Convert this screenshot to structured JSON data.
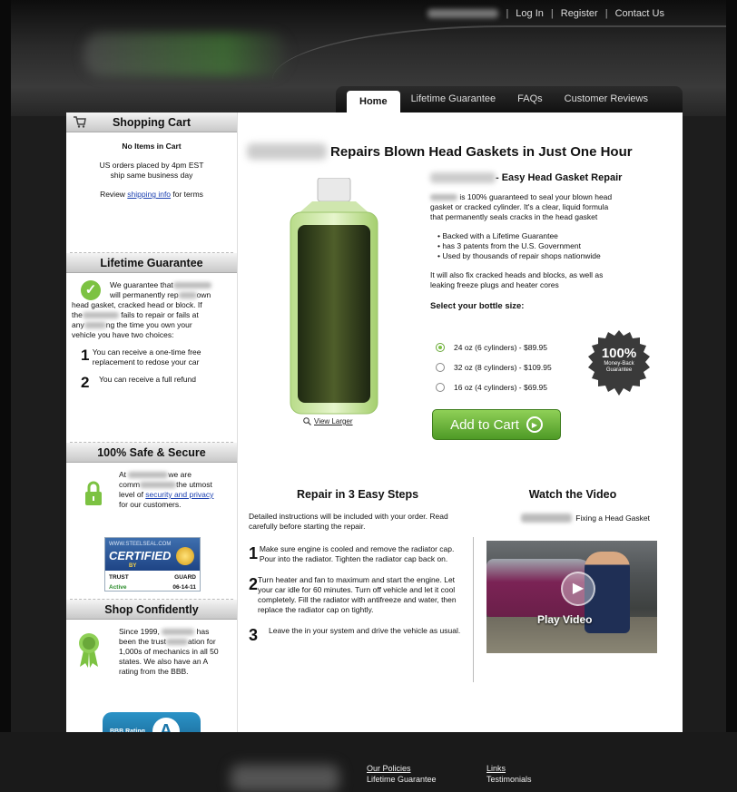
{
  "header": {
    "top_links": [
      "Log In",
      "Register",
      "Contact Us"
    ],
    "separator": "|"
  },
  "nav": {
    "tabs": [
      "Home",
      "Lifetime Guarantee",
      "FAQs",
      "Customer Reviews"
    ],
    "active": "Home"
  },
  "sidebar": {
    "cart": {
      "title": "Shopping Cart",
      "empty": "No Items in Cart",
      "ship_line1": "US orders placed by 4pm EST",
      "ship_line2": "ship same business day",
      "review_prefix": "Review ",
      "review_link": "shipping info",
      "review_suffix": " for terms"
    },
    "guarantee": {
      "title": "Lifetime Guarantee",
      "line1": "We guarantee that",
      "line2": "will permanently rep",
      "line2b": "own",
      "line3": "head gasket, cracked head or block. If",
      "line4a": "the",
      "line4b": "fails to repair or fails at",
      "line5a": "any",
      "line5b": "ng the time you own your",
      "line6": "vehicle you have two choices:",
      "choices": [
        {
          "num": "1",
          "text": "You can receive a one-time free replacement to redose your car"
        },
        {
          "num": "2",
          "text": "You can receive a full refund"
        }
      ]
    },
    "secure": {
      "title": "100% Safe & Secure",
      "line1a": "At",
      "line1b": "we are",
      "line2a": "comm",
      "line2b": "the utmost",
      "line3_prefix": "level of ",
      "line3_link": "security and privacy",
      "line4": "for our customers.",
      "badge": {
        "url": "WWW.STEELSEAL.COM",
        "certified": "CERTIFIED",
        "by": "BY",
        "trust": "TRUST",
        "guard": "GUARD",
        "active": "Active",
        "date": "06-14-11"
      }
    },
    "confident": {
      "title": "Shop Confidently",
      "line1a": "Since 1999,",
      "line1b": "has",
      "line2a": "been the trust",
      "line2b": "ation for",
      "line3": "1,000s of mechanics in all 50",
      "line4": "states.  We also have an A",
      "line5": "rating from the BBB.",
      "bbb_label": "BBB Rating",
      "bbb_grade": "A"
    }
  },
  "product": {
    "headline": "Repairs Blown Head Gaskets in Just One Hour",
    "view_larger": "View Larger",
    "subtitle": "- Easy Head Gasket Repair",
    "desc_a": "is 100% guaranteed to seal your blown head",
    "desc_b": "gasket or cracked cylinder. It's a clear, liquid formula",
    "desc_c": "that permanently seals cracks in the head gasket",
    "bullets": [
      "Backed with a Lifetime Guarantee",
      "has 3 patents from the U.S. Government",
      "Used by thousands of repair shops nationwide"
    ],
    "fix_a": "It will also fix cracked heads and blocks, as well as",
    "fix_b": "leaking freeze plugs and heater cores",
    "select_label": "Select your bottle size:",
    "options": [
      {
        "label": "24 oz (6 cylinders) - $89.95",
        "checked": true
      },
      {
        "label": "32 oz (8 cylinders) - $109.95",
        "checked": false
      },
      {
        "label": "16 oz (4 cylinders) - $69.95",
        "checked": false
      }
    ],
    "seal_pct": "100%",
    "seal_line1": "Money-Back",
    "seal_line2": "Guarantee",
    "add_to_cart": "Add to Cart"
  },
  "steps": {
    "title": "Repair in 3 Easy Steps",
    "intro": "Detailed instructions will be included with your order. Read carefully before starting the repair.",
    "items": [
      {
        "num": "1",
        "text": "Make sure engine is cooled and remove the radiator cap. Pour into the radiator. Tighten the radiator cap back on."
      },
      {
        "num": "2",
        "text": "Turn heater and fan to maximum and start the engine. Let your car idle for 60 minutes. Turn off vehicle and let it cool completely. Fill the radiator with antifreeze and water, then replace the radiator cap on tightly."
      },
      {
        "num": "3",
        "text": "Leave the in your system and drive the vehicle as usual."
      }
    ]
  },
  "video": {
    "title": "Watch the Video",
    "caption": "Fixing a Head Gasket",
    "play": "Play Video"
  },
  "footer": {
    "col1": [
      "Our Policies",
      "Lifetime Guarantee"
    ],
    "col2": [
      "Links",
      "Testimonials"
    ]
  },
  "colors": {
    "accent_green": "#7cc242",
    "link_blue": "#1a3fb0",
    "header_dark": "#2a2a2a"
  }
}
